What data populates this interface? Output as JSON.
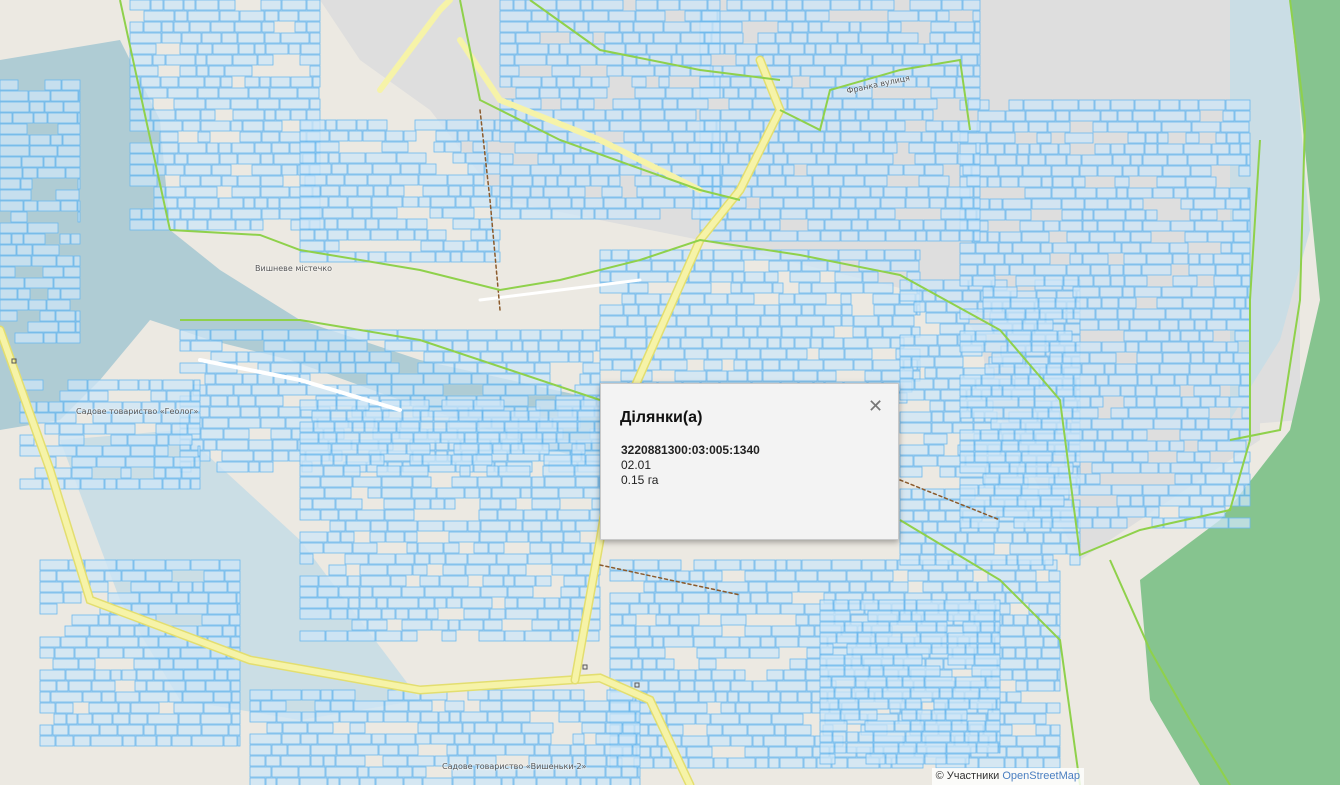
{
  "map": {
    "colors": {
      "background": "#ece9e2",
      "water": "#a9c9d3",
      "forest": "#86c48f",
      "parcel_fill": "#cde5f7",
      "parcel_stroke": "#6cb8ee",
      "road_main": "#f6f3a8",
      "road_edge": "#e3de6f",
      "boundary": "#8fd14b",
      "building": "#d6d6d6"
    },
    "labels": {
      "village": "Вишневе містечко",
      "garden_geolog": "Садове товариство «Геолог»",
      "garden_vyshenky": "Садове товариство «Вишеньки-2»",
      "street_1": "Франка вулиця"
    }
  },
  "popup": {
    "title": "Ділянки(а)",
    "close_icon": "close-icon",
    "cadastral_number": "3220881300:03:005:1340",
    "purpose_code": "02.01",
    "area": "0.15 га"
  },
  "attribution": {
    "prefix": "© Участники",
    "link": "OpenStreetMap"
  }
}
